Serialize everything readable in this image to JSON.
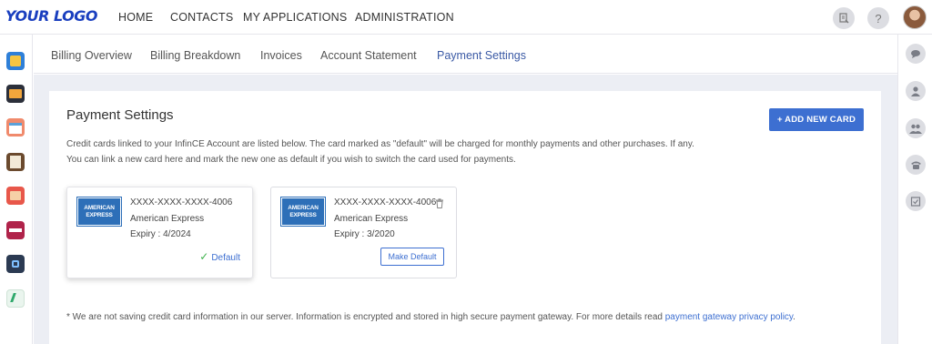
{
  "header": {
    "logo": "YOUR LOGO",
    "nav": [
      "HOME",
      "CONTACTS",
      "MY APPLICATIONS",
      "ADMINISTRATION"
    ],
    "icons": [
      "edit-document-icon",
      "help-icon",
      "avatar"
    ]
  },
  "tabs": [
    {
      "label": "Billing Overview",
      "active": false
    },
    {
      "label": "Billing Breakdown",
      "active": false
    },
    {
      "label": "Invoices",
      "active": false
    },
    {
      "label": "Account Statement",
      "active": false
    },
    {
      "label": "Payment Settings",
      "active": true
    }
  ],
  "left_sidebar": [
    "notes-app-icon",
    "mail-app-icon",
    "calendar-app-icon",
    "clipboard-app-icon",
    "photos-app-icon",
    "ecom-app-icon",
    "link-app-icon",
    "sign-app-icon"
  ],
  "right_sidebar": [
    "chat-icon",
    "user-icon",
    "group-icon",
    "phone-icon",
    "calendar-check-icon"
  ],
  "page": {
    "title": "Payment Settings",
    "add_button": "+ ADD NEW CARD",
    "description": "Credit cards linked to your InfinCE Account are listed below. The card marked as \"default\" will be charged for monthly payments and other purchases. If any. You can link a new card here and mark the new one as default if you wish to switch the card used for payments."
  },
  "cards": [
    {
      "brand_logo": [
        "AMERICAN",
        "EXPRESS"
      ],
      "number": "XXXX-XXXX-XXXX-4006",
      "type": "American Express",
      "expiry": "Expiry : 4/2024",
      "status": "Default"
    },
    {
      "brand_logo": [
        "AMERICAN",
        "EXPRESS"
      ],
      "number": "XXXX-XXXX-XXXX-4006",
      "type": "American Express",
      "expiry": "Expiry : 3/2020",
      "action": "Make Default"
    }
  ],
  "note": {
    "text": "* We are not saving credit card information in our server. Information is encrypted and stored in high secure payment gateway. For more details read ",
    "link": "payment gateway privacy policy",
    "end": "."
  },
  "colors": {
    "accent": "#3d6fd1",
    "logo": "#1a3fbf",
    "default_check": "#3fb24d"
  }
}
